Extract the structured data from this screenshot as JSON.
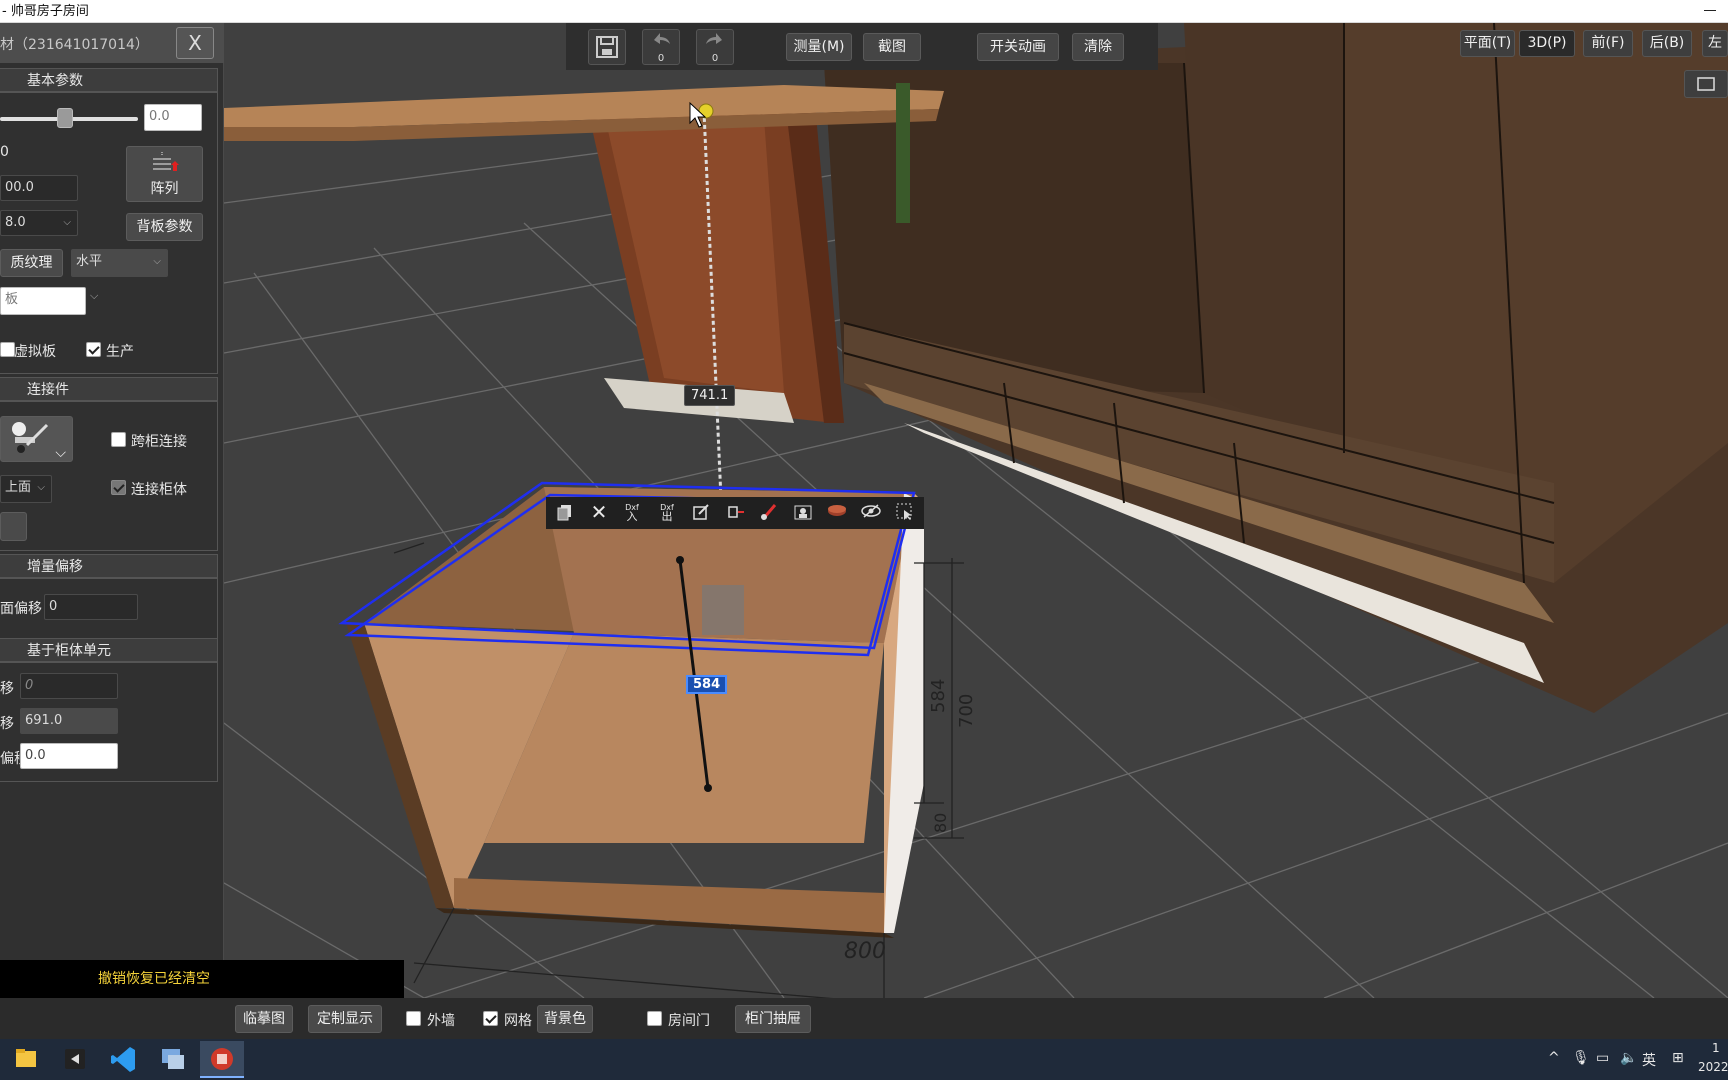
{
  "window": {
    "title": "- 帅哥房子房间"
  },
  "left_panel": {
    "header_title": "材（231641017014）",
    "close_label": "X",
    "basic_params": {
      "heading": "基本参数",
      "slider_value": "0.0",
      "label_zero": "0",
      "field_1": "00.0",
      "field_2": "8.0",
      "array_label": "阵列",
      "back_panel_button": "背板参数",
      "texture_button": "质纹理",
      "texture_direction": "水平",
      "board_field": "板",
      "virtual_board_label": "虚拟板",
      "virtual_board_checked": false,
      "production_label": "生产",
      "production_checked": true
    },
    "connectors": {
      "heading": "连接件",
      "cross_cabinet_label": "跨柜连接",
      "cross_cabinet_checked": false,
      "position_value": "上面",
      "connect_cabinet_label": "连接柜体",
      "connect_cabinet_checked": true
    },
    "offset": {
      "heading": "增量偏移",
      "face_offset_label": "面偏移",
      "face_offset_value": "0"
    },
    "cabinet_unit": {
      "heading": "基于柜体单元",
      "row1_label": "移",
      "row1_value": "0",
      "row2_label": "移",
      "row2_value": "691.0",
      "row3_label": "偏移",
      "row3_value": "0.0"
    }
  },
  "status_message": "撤销恢复已经清空",
  "top_toolbar": {
    "undo_count": "0",
    "redo_count": "0",
    "measure_label": "测量(M)",
    "screenshot_label": "截图",
    "toggle_anim_label": "开关动画",
    "clear_label": "清除"
  },
  "view_buttons": {
    "plan": "平面(T)",
    "three_d": "3D(P)",
    "front": "前(F)",
    "back": "后(B)",
    "left": "左"
  },
  "scene": {
    "measure_value": "741.1",
    "inner_depth_value": "584",
    "dim_584": "584",
    "dim_700": "700",
    "dim_80": "80",
    "dim_800": "800"
  },
  "float_toolbar": {
    "dxf_in_top": "Dxf",
    "dxf_in_bottom": "入",
    "dxf_out_top": "Dxf",
    "dxf_out_bottom": "出"
  },
  "bottom_toolbar": {
    "trace_label": "临摹图",
    "custom_display_label": "定制显示",
    "outer_wall_label": "外墙",
    "outer_wall_checked": false,
    "grid_label": "网格",
    "grid_checked": true,
    "bg_color_label": "背景色",
    "room_door_label": "房间门",
    "room_door_checked": false,
    "cabinet_door_drawer_label": "柜门抽屉"
  },
  "taskbar": {
    "ime_label": "英",
    "time": "1",
    "date": "2022"
  },
  "colors": {
    "selection_blue": "#1f2ef0",
    "status_yellow": "#f5d33a",
    "wood": "#a9774d",
    "dark_wood": "#4a3526"
  }
}
